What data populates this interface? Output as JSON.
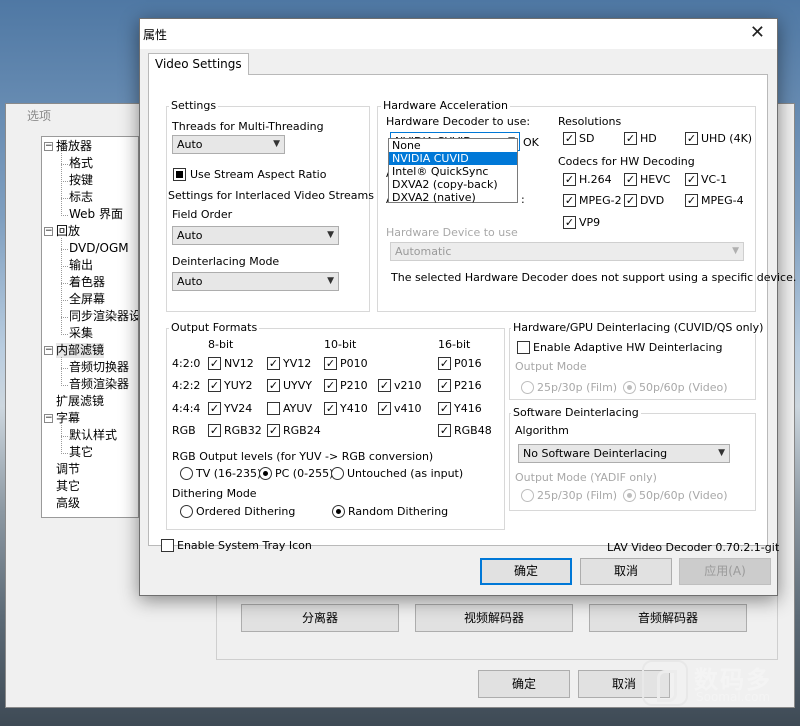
{
  "background_window": {
    "title": "选项",
    "tree": [
      {
        "label": "播放器",
        "level": 0,
        "expander": "−"
      },
      {
        "label": "格式",
        "level": 1
      },
      {
        "label": "按键",
        "level": 1
      },
      {
        "label": "标志",
        "level": 1
      },
      {
        "label": "Web 界面",
        "level": 1
      },
      {
        "label": "回放",
        "level": 0,
        "expander": "−"
      },
      {
        "label": "DVD/OGM",
        "level": 1
      },
      {
        "label": "输出",
        "level": 1
      },
      {
        "label": "着色器",
        "level": 1
      },
      {
        "label": "全屏幕",
        "level": 1
      },
      {
        "label": "同步渲染器设",
        "level": 1
      },
      {
        "label": "采集",
        "level": 1
      },
      {
        "label": "内部滤镜",
        "level": 0,
        "expander": "−",
        "selected": true
      },
      {
        "label": "音频切换器",
        "level": 1
      },
      {
        "label": "音频渲染器",
        "level": 1
      },
      {
        "label": "扩展滤镜",
        "level": 0
      },
      {
        "label": "字幕",
        "level": 0,
        "expander": "−"
      },
      {
        "label": "默认样式",
        "level": 1
      },
      {
        "label": "其它",
        "level": 1
      },
      {
        "label": "调节",
        "level": 0
      },
      {
        "label": "其它",
        "level": 0
      },
      {
        "label": "高级",
        "level": 0
      }
    ],
    "panel_buttons": [
      "分离器",
      "视频解码器",
      "音频解码器"
    ],
    "ok_label": "确定",
    "cancel_label": "取消"
  },
  "dialog": {
    "title": "属性",
    "close_glyph": "✕",
    "tab_label": "Video Settings",
    "settings": {
      "group_title": "Settings",
      "threads_label": "Threads for Multi-Threading",
      "threads_value": "Auto",
      "stream_aspect_label": "Use Stream Aspect Ratio",
      "interlaced_label": "Settings for Interlaced Video Streams",
      "field_order_label": "Field Order",
      "field_order_value": "Auto",
      "deint_mode_label": "Deinterlacing Mode",
      "deint_mode_value": "Auto"
    },
    "hw_accel": {
      "group_title": "Hardware Acceleration",
      "decoder_label": "Hardware Decoder to use:",
      "decoder_value": "NVIDIA CUVID",
      "ok_status": "OK",
      "decoder_options": [
        "None",
        "NVIDIA CUVID",
        "Intel® QuickSync",
        "DXVA2 (copy-back)",
        "DXVA2 (native)"
      ],
      "selected_option": "NVIDIA CUVID",
      "hidden_fragment_1": "A",
      "hidden_fragment_2": "A",
      "hidden_fragment_3": ":",
      "device_label": "Hardware Device to use",
      "device_value": "Automatic",
      "note": "The selected Hardware Decoder does not support using a specific device.",
      "resolutions_label": "Resolutions",
      "resolutions": [
        {
          "label": "SD",
          "checked": true
        },
        {
          "label": "HD",
          "checked": true
        },
        {
          "label": "UHD (4K)",
          "checked": true
        }
      ],
      "codecs_label": "Codecs for HW Decoding",
      "codecs": [
        {
          "label": "H.264",
          "checked": true
        },
        {
          "label": "HEVC",
          "checked": true
        },
        {
          "label": "VC-1",
          "checked": true
        },
        {
          "label": "MPEG-2",
          "checked": true
        },
        {
          "label": "DVD",
          "checked": true
        },
        {
          "label": "MPEG-4",
          "checked": true
        },
        {
          "label": "VP9",
          "checked": true
        }
      ]
    },
    "output_formats": {
      "group_title": "Output Formats",
      "col_headers": [
        "8-bit",
        "10-bit",
        "16-bit"
      ],
      "rows": [
        {
          "label": "4:2:0",
          "items": [
            {
              "label": "NV12",
              "checked": true
            },
            {
              "label": "YV12",
              "checked": true
            },
            {
              "label": "P010",
              "checked": true
            },
            {
              "label": "P016",
              "checked": true
            }
          ]
        },
        {
          "label": "4:2:2",
          "items": [
            {
              "label": "YUY2",
              "checked": true
            },
            {
              "label": "UYVY",
              "checked": true
            },
            {
              "label": "P210",
              "checked": true
            },
            {
              "label": "v210",
              "checked": true
            },
            {
              "label": "P216",
              "checked": true
            }
          ]
        },
        {
          "label": "4:4:4",
          "items": [
            {
              "label": "YV24",
              "checked": true
            },
            {
              "label": "AYUV",
              "checked": false
            },
            {
              "label": "Y410",
              "checked": true
            },
            {
              "label": "v410",
              "checked": true
            },
            {
              "label": "Y416",
              "checked": true
            }
          ]
        },
        {
          "label": "RGB",
          "items": [
            {
              "label": "RGB32",
              "checked": true
            },
            {
              "label": "RGB24",
              "checked": true
            },
            {
              "label": "RGB48",
              "checked": true
            }
          ]
        }
      ],
      "rgb_levels_label": "RGB Output levels (for YUV -> RGB conversion)",
      "rgb_levels": [
        {
          "label": "TV (16-235)",
          "selected": false
        },
        {
          "label": "PC (0-255)",
          "selected": true
        },
        {
          "label": "Untouched (as input)",
          "selected": false
        }
      ],
      "dithering_label": "Dithering Mode",
      "dithering": [
        {
          "label": "Ordered Dithering",
          "selected": false
        },
        {
          "label": "Random Dithering",
          "selected": true
        }
      ]
    },
    "hw_deint": {
      "group_title": "Hardware/GPU Deinterlacing (CUVID/QS only)",
      "enable_label": "Enable Adaptive HW Deinterlacing",
      "output_mode_label": "Output Mode",
      "options": [
        "25p/30p (Film)",
        "50p/60p (Video)"
      ]
    },
    "sw_deint": {
      "group_title": "Software Deinterlacing",
      "algorithm_label": "Algorithm",
      "algorithm_value": "No Software Deinterlacing",
      "output_mode_label": "Output Mode (YADIF only)",
      "options": [
        "25p/30p (Film)",
        "50p/60p (Video)"
      ]
    },
    "tray_icon_label": "Enable System Tray Icon",
    "version": "LAV Video Decoder 0.70.2.1-git",
    "ok_label": "确定",
    "cancel_label": "取消",
    "apply_label": "应用(A)"
  },
  "watermark": {
    "cn": "数码多",
    "en": "Soomal.com"
  }
}
